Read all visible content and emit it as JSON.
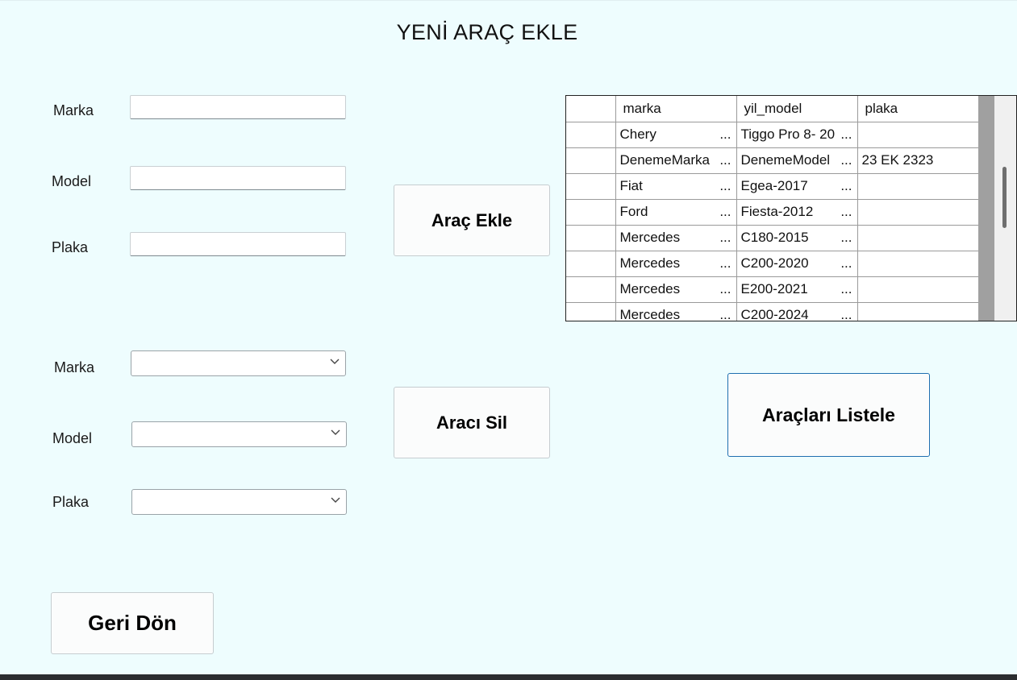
{
  "page": {
    "title": "YENİ ARAÇ EKLE"
  },
  "add_form": {
    "brand_label": "Marka",
    "model_label": "Model",
    "plate_label": "Plaka",
    "brand_value": "",
    "model_value": "",
    "plate_value": "",
    "add_button": "Araç Ekle"
  },
  "delete_form": {
    "brand_label": "Marka",
    "model_label": "Model",
    "plate_label": "Plaka",
    "brand_selected": "",
    "model_selected": "",
    "plate_selected": "",
    "delete_button": "Aracı Sil"
  },
  "list_button": "Araçları Listele",
  "back_button": "Geri Dön",
  "grid": {
    "columns": [
      "",
      "marka",
      "yil_model",
      "plaka"
    ],
    "rows": [
      {
        "marka": "Chery",
        "yil_model": "Tiggo Pro 8- 20",
        "plaka": ""
      },
      {
        "marka": "DenemeMarka",
        "yil_model": "DenemeModel",
        "plaka": "23 EK 2323"
      },
      {
        "marka": "Fiat",
        "yil_model": "Egea-2017",
        "plaka": ""
      },
      {
        "marka": "Ford",
        "yil_model": "Fiesta-2012",
        "plaka": ""
      },
      {
        "marka": "Mercedes",
        "yil_model": "C180-2015",
        "plaka": ""
      },
      {
        "marka": "Mercedes",
        "yil_model": "C200-2020",
        "plaka": ""
      },
      {
        "marka": "Mercedes",
        "yil_model": "E200-2021",
        "plaka": ""
      },
      {
        "marka": "Mercedes",
        "yil_model": "C200-2024",
        "plaka": ""
      }
    ],
    "ellipsis": "..."
  },
  "icons": {
    "combo": "chevron-down-icon"
  },
  "colors": {
    "background": "#eefdfe",
    "primary_border": "#1f6fb0"
  }
}
